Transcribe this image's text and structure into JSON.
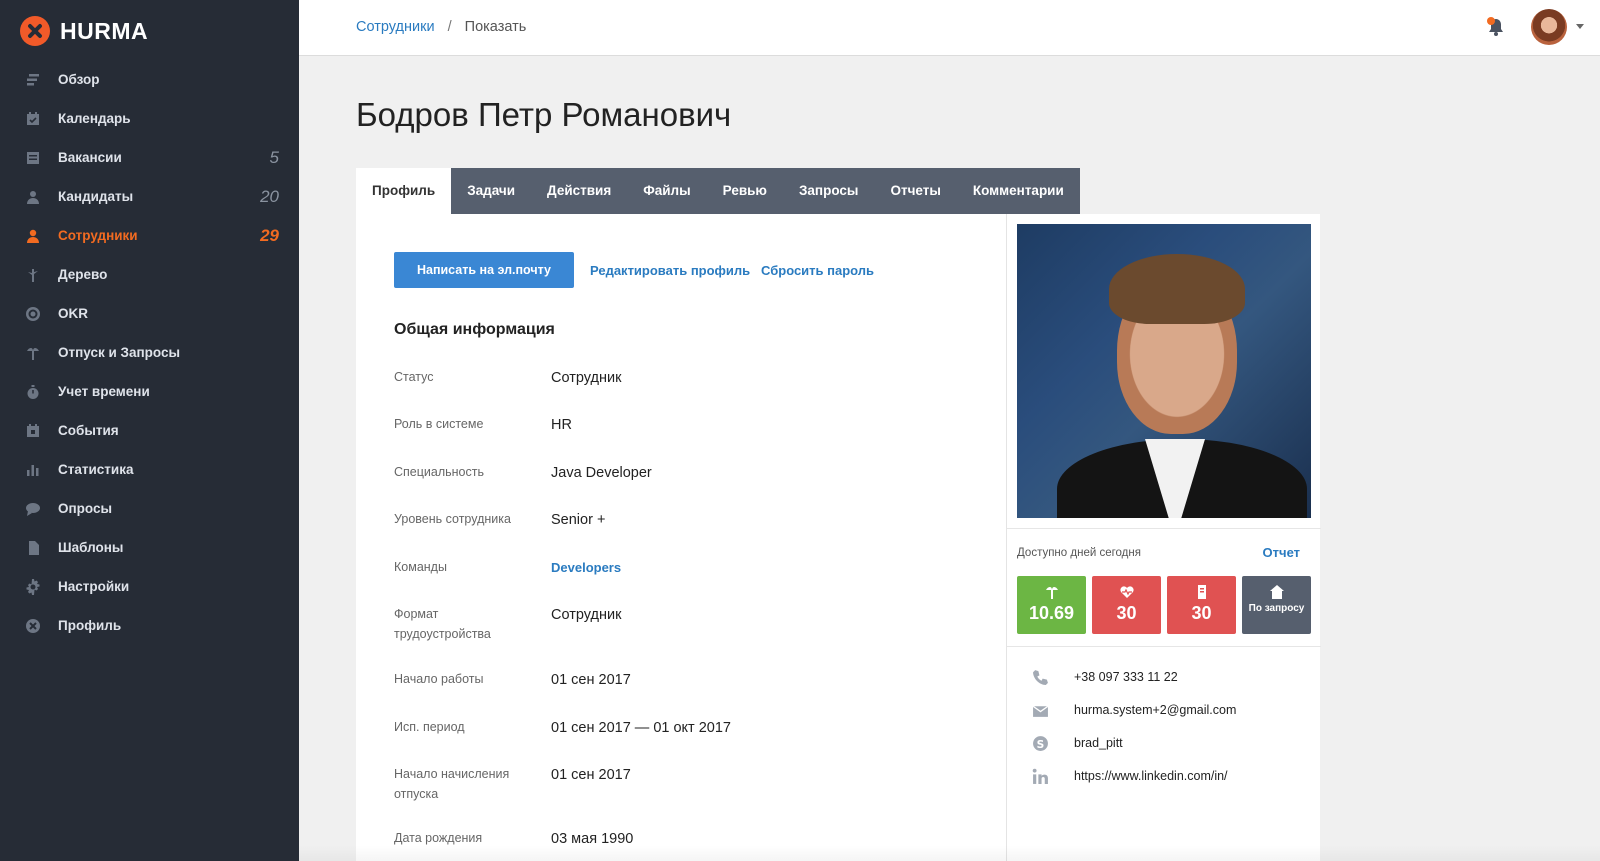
{
  "app": {
    "name": "HURMA"
  },
  "sidebar": {
    "items": [
      {
        "label": "Обзор",
        "icon": "overview-icon",
        "count": ""
      },
      {
        "label": "Календарь",
        "icon": "calendar-icon",
        "count": ""
      },
      {
        "label": "Вакансии",
        "icon": "vacancies-icon",
        "count": "5"
      },
      {
        "label": "Кандидаты",
        "icon": "candidates-icon",
        "count": "20"
      },
      {
        "label": "Сотрудники",
        "icon": "employees-icon",
        "count": "29",
        "active": true
      },
      {
        "label": "Дерево",
        "icon": "tree-icon",
        "count": ""
      },
      {
        "label": "OKR",
        "icon": "target-icon",
        "count": ""
      },
      {
        "label": "Отпуск и Запросы",
        "icon": "palm-icon",
        "count": ""
      },
      {
        "label": "Учет времени",
        "icon": "stopwatch-icon",
        "count": ""
      },
      {
        "label": "События",
        "icon": "events-icon",
        "count": ""
      },
      {
        "label": "Статистика",
        "icon": "stats-icon",
        "count": ""
      },
      {
        "label": "Опросы",
        "icon": "chat-icon",
        "count": ""
      },
      {
        "label": "Шаблоны",
        "icon": "templates-icon",
        "count": ""
      },
      {
        "label": "Настройки",
        "icon": "gear-icon",
        "count": ""
      },
      {
        "label": "Профиль",
        "icon": "profile-icon",
        "count": ""
      }
    ]
  },
  "breadcrumb": {
    "parent": "Сотрудники",
    "separator": "/",
    "current": "Показать"
  },
  "page": {
    "title": "Бодров Петр Романович"
  },
  "tabs": [
    "Профиль",
    "Задачи",
    "Действия",
    "Файлы",
    "Ревью",
    "Запросы",
    "Отчеты",
    "Комментарии"
  ],
  "actions": {
    "email_button": "Написать на эл.почту",
    "edit_profile": "Редактировать профиль",
    "reset_password": "Сбросить пароль"
  },
  "general": {
    "title": "Общая информация",
    "fields": [
      {
        "label": "Статус",
        "value": "Сотрудник"
      },
      {
        "label": "Роль в системе",
        "value": "HR"
      },
      {
        "label": "Специальность",
        "value": "Java Developer"
      },
      {
        "label": "Уровень сотрудника",
        "value": "Senior +"
      },
      {
        "label": "Команды",
        "value": "Developers",
        "link": true
      },
      {
        "label": "Формат трудоустройства",
        "value": "Сотрудник"
      },
      {
        "label": "Начало работы",
        "value": "01 сен 2017"
      },
      {
        "label": "Исп. период",
        "value": "01 сен 2017 — 01 окт 2017"
      },
      {
        "label": "Начало начисления отпуска",
        "value": "01 сен 2017"
      },
      {
        "label": "Дата рождения",
        "value": "03 мая 1990"
      }
    ]
  },
  "availability": {
    "label": "Доступно дней сегодня",
    "report_link": "Отчет",
    "tiles": [
      {
        "icon": "palm-icon",
        "value": "10.69",
        "color": "#6cb644"
      },
      {
        "icon": "heart-icon",
        "value": "30",
        "color": "#e05252"
      },
      {
        "icon": "document-icon",
        "value": "30",
        "color": "#e05252"
      },
      {
        "icon": "home-icon",
        "value": "По запросу",
        "color": "#565f6e"
      }
    ]
  },
  "contacts": [
    {
      "icon": "phone-icon",
      "value": "+38 097 333 11 22"
    },
    {
      "icon": "mail-icon",
      "value": "hurma.system+2@gmail.com"
    },
    {
      "icon": "skype-icon",
      "value": "brad_pitt"
    },
    {
      "icon": "linkedin-icon",
      "value": "https://www.linkedin.com/in/"
    }
  ],
  "colors": {
    "sidebar_bg": "#262c36",
    "accent": "#f26b21",
    "link": "#2a7bc0",
    "primary_button": "#3a87d4"
  }
}
